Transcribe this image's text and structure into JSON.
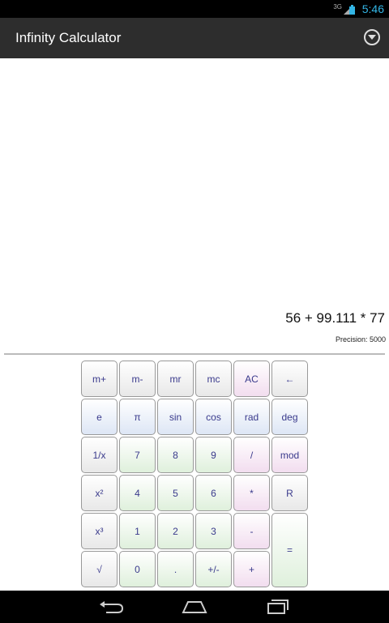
{
  "status_bar": {
    "network": "3G",
    "time": "5:46"
  },
  "app": {
    "title": "Infinity Calculator"
  },
  "display": {
    "expression": "56 + 99.111 * 77",
    "precision": "Precision: 5000"
  },
  "keypad": {
    "rows": [
      [
        "m+",
        "m-",
        "mr",
        "mc",
        "AC",
        "←"
      ],
      [
        "e",
        "π",
        "sin",
        "cos",
        "rad",
        "deg"
      ],
      [
        "1/x",
        "7",
        "8",
        "9",
        "/",
        "mod"
      ],
      [
        "x²",
        "4",
        "5",
        "6",
        "*",
        "R"
      ],
      [
        "x³",
        "1",
        "2",
        "3",
        "-",
        "="
      ],
      [
        "√",
        "0",
        ".",
        "+/-",
        "+"
      ]
    ]
  },
  "colors": {
    "accent": "#33b5e5",
    "action_bar": "#2d2d2d",
    "key_text": "#3a3a8c"
  },
  "nav": {
    "icons": [
      "back-icon",
      "home-icon",
      "recent-apps-icon"
    ]
  }
}
